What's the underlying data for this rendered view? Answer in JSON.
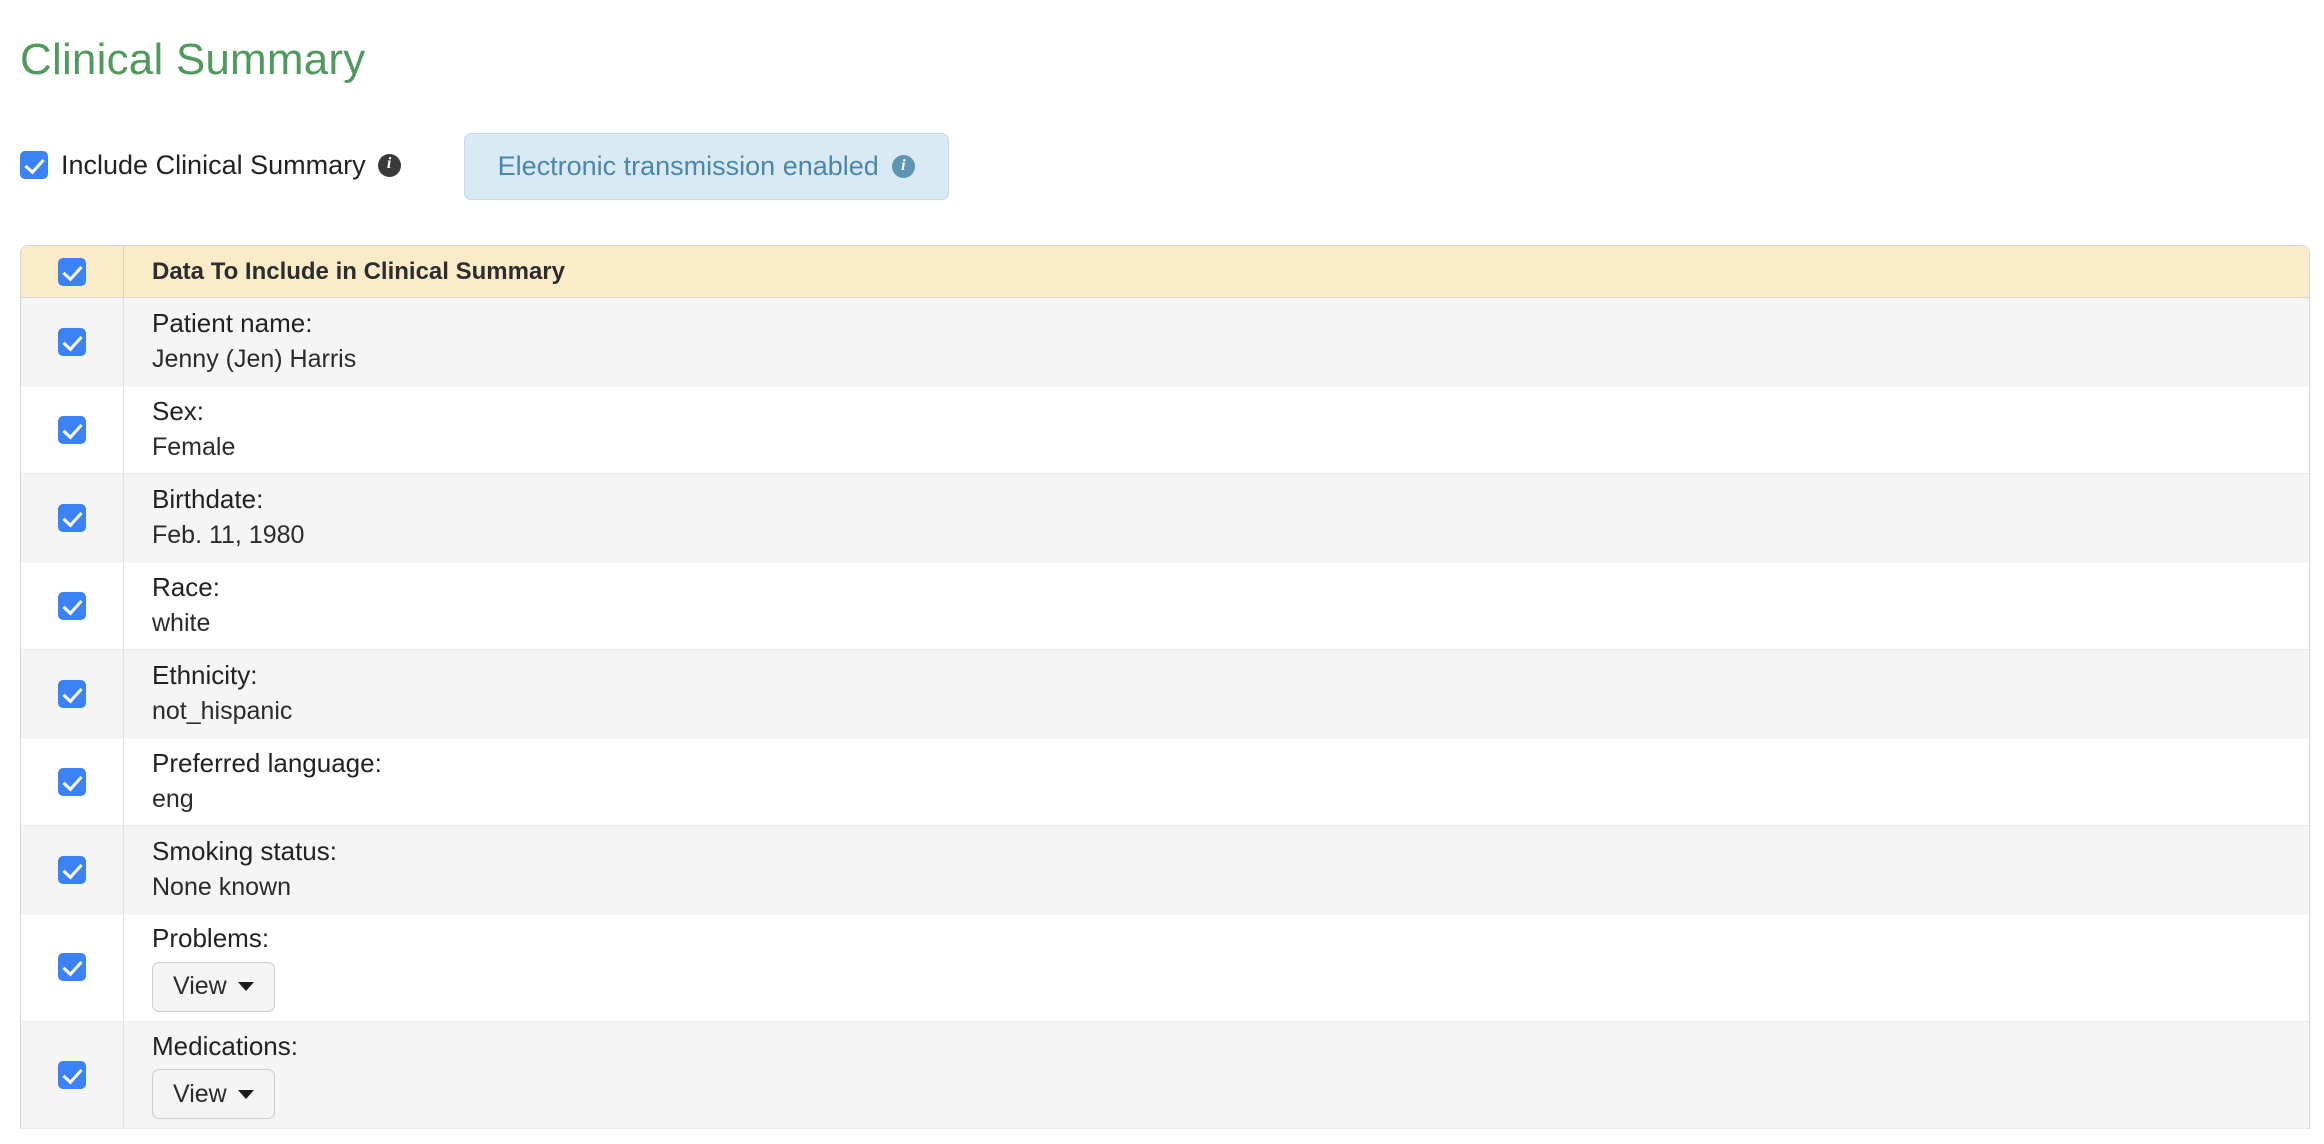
{
  "page": {
    "title": "Clinical Summary"
  },
  "controls": {
    "include_checkbox_label": "Include Clinical Summary",
    "include_info_icon": "info-icon",
    "include_checked": true,
    "badge": {
      "text": "Electronic transmission enabled",
      "info_icon": "info-icon"
    }
  },
  "table": {
    "header": {
      "select_all_checked": true,
      "column_label": "Data To Include in Clinical Summary"
    },
    "rows": [
      {
        "checked": true,
        "label": "Patient name:",
        "value": "Jenny (Jen) Harris",
        "control": "text"
      },
      {
        "checked": true,
        "label": "Sex:",
        "value": "Female",
        "control": "text"
      },
      {
        "checked": true,
        "label": "Birthdate:",
        "value": "Feb. 11, 1980",
        "control": "text"
      },
      {
        "checked": true,
        "label": "Race:",
        "value": "white",
        "control": "text"
      },
      {
        "checked": true,
        "label": "Ethnicity:",
        "value": "not_hispanic",
        "control": "text"
      },
      {
        "checked": true,
        "label": "Preferred language:",
        "value": "eng",
        "control": "text"
      },
      {
        "checked": true,
        "label": "Smoking status:",
        "value": "None known",
        "control": "text"
      },
      {
        "checked": true,
        "label": "Problems:",
        "value": "View",
        "control": "dropdown"
      },
      {
        "checked": true,
        "label": "Medications:",
        "value": "View",
        "control": "dropdown"
      }
    ]
  },
  "colors": {
    "title_green": "#4f9a5c",
    "checkbox_blue": "#3b82f6",
    "header_cream": "#faecc8",
    "badge_bg": "#d9eaf4",
    "badge_text": "#4a87ab",
    "row_alt": "#f5f5f5"
  }
}
